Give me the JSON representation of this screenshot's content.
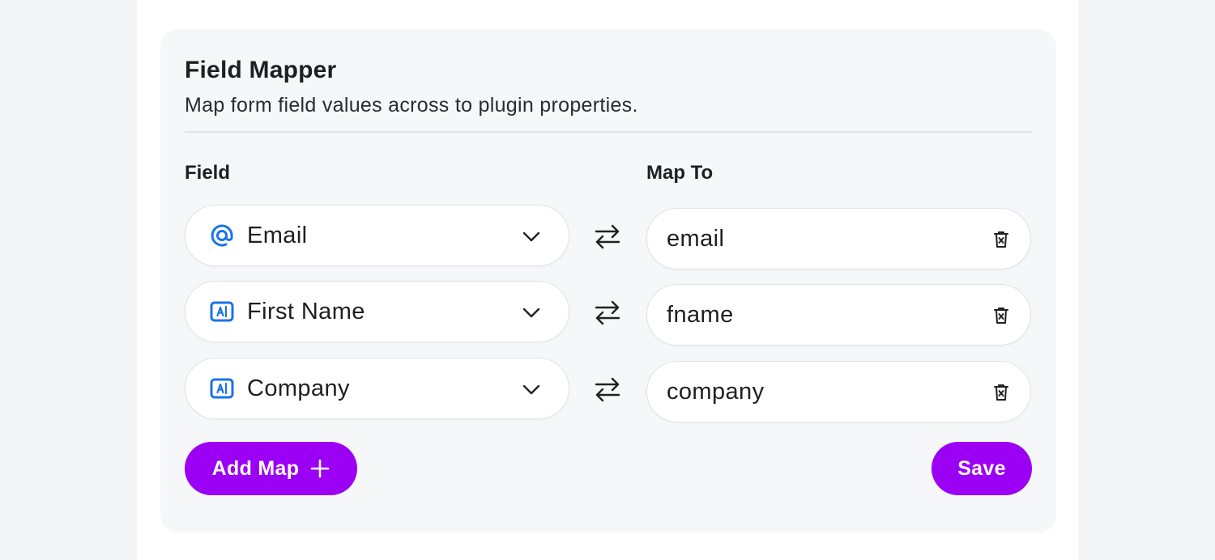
{
  "mapper": {
    "title": "Field Mapper",
    "subtitle": "Map form field values across to plugin properties.",
    "field_header": "Field",
    "mapto_header": "Map To",
    "rows": [
      {
        "field": "Email",
        "field_icon": "at-sign-icon",
        "map_to": "email"
      },
      {
        "field": "First Name",
        "field_icon": "text-field-icon",
        "map_to": "fname"
      },
      {
        "field": "Company",
        "field_icon": "text-field-icon",
        "map_to": "company"
      }
    ],
    "add_button": "Add Map",
    "save_button": "Save"
  },
  "colors": {
    "accent": "#9b00f5",
    "icon_blue": "#1a73e8",
    "card_bg": "#f6f7f9",
    "page_bg": "#f3f4f6"
  }
}
